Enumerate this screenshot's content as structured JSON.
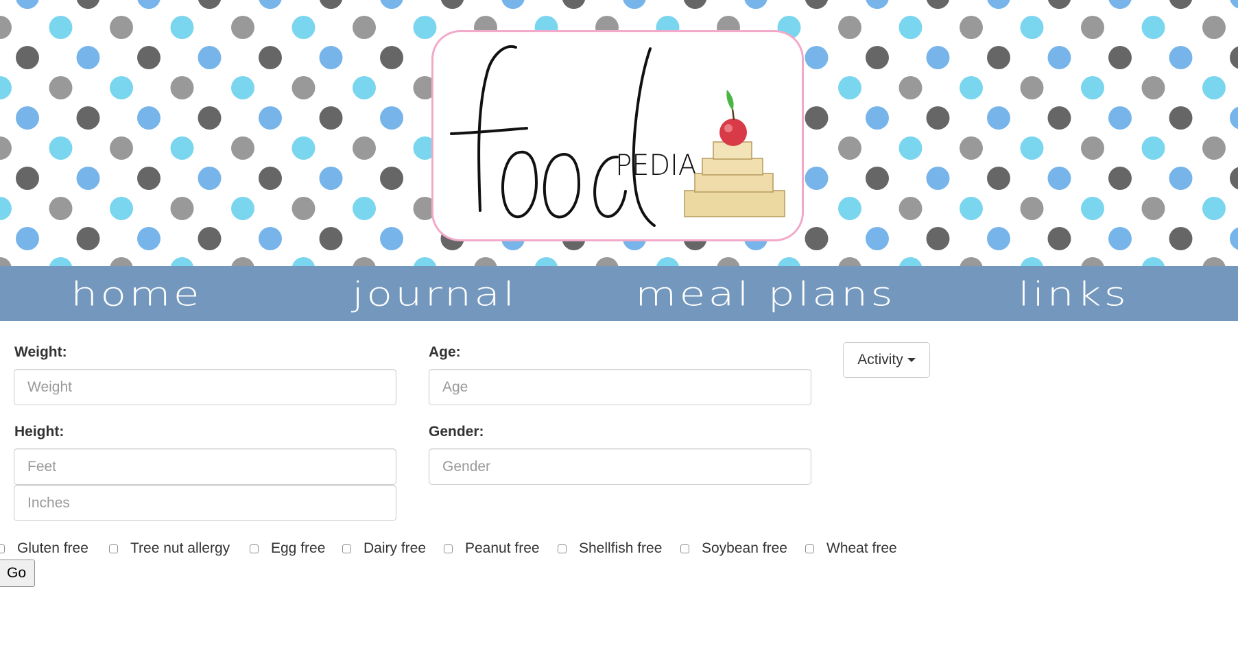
{
  "header": {
    "logo": {
      "word_main": "food",
      "word_sub": "PEDIA",
      "icon": "apple-on-books-icon"
    },
    "colors": {
      "dot_dark": "#666666",
      "dot_grey": "#999999",
      "dot_blue": "#76b4ea",
      "dot_cyan": "#7ad5ee",
      "logo_border": "#f2a9c9"
    }
  },
  "nav": {
    "background": "#7498bd",
    "items": [
      {
        "label": "home"
      },
      {
        "label": "journal"
      },
      {
        "label": "meal plans"
      },
      {
        "label": "links"
      }
    ]
  },
  "form": {
    "weight": {
      "label": "Weight:",
      "placeholder": "Weight",
      "value": ""
    },
    "age": {
      "label": "Age:",
      "placeholder": "Age",
      "value": ""
    },
    "height": {
      "label": "Height:",
      "feet_placeholder": "Feet",
      "inches_placeholder": "Inches"
    },
    "gender": {
      "label": "Gender:",
      "placeholder": "Gender",
      "value": ""
    },
    "activity": {
      "label": "Activity",
      "icon": "caret-down-icon"
    },
    "allergies": [
      {
        "label": "Gluten free",
        "checked": false
      },
      {
        "label": "Tree nut allergy",
        "checked": false
      },
      {
        "label": "Egg free",
        "checked": false
      },
      {
        "label": "Dairy free",
        "checked": false
      },
      {
        "label": "Peanut free",
        "checked": false
      },
      {
        "label": "Shellfish free",
        "checked": false
      },
      {
        "label": "Soybean free",
        "checked": false
      },
      {
        "label": "Wheat free",
        "checked": false
      }
    ],
    "go_label": "Go"
  }
}
